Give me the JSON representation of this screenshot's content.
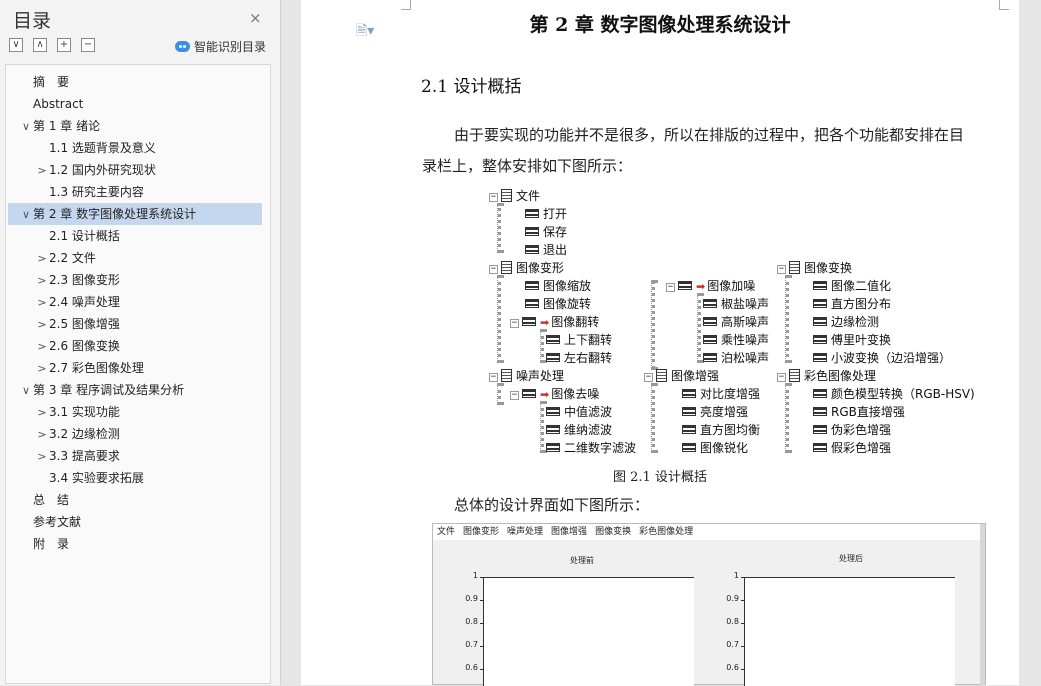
{
  "sidebar": {
    "title": "目录",
    "close": "×",
    "tools": [
      "∨",
      "∧",
      "+",
      "−"
    ],
    "ai_button": "智能识别目录",
    "items": [
      {
        "label": "摘　要",
        "level": 0,
        "chev": "",
        "selected": false
      },
      {
        "label": "Abstract",
        "level": 0,
        "chev": "",
        "selected": false
      },
      {
        "label": "第 1 章  绪论",
        "level": 0,
        "chev": "∨",
        "selected": false
      },
      {
        "label": "1.1 选题背景及意义",
        "level": 1,
        "chev": "",
        "selected": false
      },
      {
        "label": "1.2 国内外研究现状",
        "level": 1,
        "chev": ">",
        "selected": false
      },
      {
        "label": "1.3 研究主要内容",
        "level": 1,
        "chev": "",
        "selected": false
      },
      {
        "label": "第 2 章  数字图像处理系统设计",
        "level": 0,
        "chev": "∨",
        "selected": true
      },
      {
        "label": "2.1 设计概括",
        "level": 1,
        "chev": "",
        "selected": false
      },
      {
        "label": "2.2 文件",
        "level": 1,
        "chev": ">",
        "selected": false
      },
      {
        "label": "2.3 图像变形",
        "level": 1,
        "chev": ">",
        "selected": false
      },
      {
        "label": "2.4 噪声处理",
        "level": 1,
        "chev": ">",
        "selected": false
      },
      {
        "label": "2.5 图像增强",
        "level": 1,
        "chev": ">",
        "selected": false
      },
      {
        "label": "2.6 图像变换",
        "level": 1,
        "chev": ">",
        "selected": false
      },
      {
        "label": "2.7 彩色图像处理",
        "level": 1,
        "chev": ">",
        "selected": false
      },
      {
        "label": "第 3 章  程序调试及结果分析",
        "level": 0,
        "chev": "∨",
        "selected": false
      },
      {
        "label": "3.1 实现功能",
        "level": 1,
        "chev": ">",
        "selected": false
      },
      {
        "label": "3.2 边缘检测",
        "level": 1,
        "chev": ">",
        "selected": false
      },
      {
        "label": "3.3 提高要求",
        "level": 1,
        "chev": ">",
        "selected": false
      },
      {
        "label": "3.4 实验要求拓展",
        "level": 1,
        "chev": "",
        "selected": false
      },
      {
        "label": "总　结",
        "level": 0,
        "chev": "",
        "selected": false
      },
      {
        "label": "参考文献",
        "level": 0,
        "chev": "",
        "selected": false
      },
      {
        "label": "附　录",
        "level": 0,
        "chev": "",
        "selected": false
      }
    ]
  },
  "document": {
    "chapter_title": "第 2 章  数字图像处理系统设计",
    "section_title": "2.1 设计概括",
    "para1_line1": "由于要实现的功能并不是很多，所以在排版的过程中，把各个功能都安排在目",
    "para1_line2": "录栏上，整体安排如下图所示：",
    "fig_caption": "图 2.1  设计概括",
    "para2": "总体的设计界面如下图所示：",
    "tree": {
      "file": {
        "label": "文件",
        "items": [
          "打开",
          "保存",
          "退出"
        ]
      },
      "deform": {
        "label": "图像变形",
        "items": [
          "图像缩放",
          "图像旋转"
        ],
        "flip": {
          "label": "图像翻转",
          "items": [
            "上下翻转",
            "左右翻转"
          ]
        }
      },
      "noise_add": {
        "label": "图像加噪",
        "items": [
          "椒盐噪声",
          "高斯噪声",
          "乘性噪声",
          "泊松噪声"
        ]
      },
      "transform": {
        "label": "图像变换",
        "items": [
          "图像二值化",
          "直方图分布",
          "边缘检测",
          "傅里叶变换",
          "小波变换（边沿增强）"
        ]
      },
      "noise": {
        "label": "噪声处理",
        "denoise": {
          "label": "图像去噪",
          "items": [
            "中值滤波",
            "维纳滤波",
            "二维数字滤波"
          ]
        }
      },
      "enhance": {
        "label": "图像增强",
        "items": [
          "对比度增强",
          "亮度增强",
          "直方图均衡",
          "图像锐化"
        ]
      },
      "color": {
        "label": "彩色图像处理",
        "items": [
          "颜色模型转换（RGB-HSV)",
          "RGB直接增强",
          "伪彩色增强",
          "假彩色增强"
        ]
      }
    },
    "screenshot": {
      "menu": [
        "文件",
        "图像变形",
        "噪声处理",
        "图像增强",
        "图像变换",
        "彩色图像处理"
      ],
      "plot_left_title": "处理前",
      "plot_right_title": "处理后",
      "yticks": [
        "1",
        "0.9",
        "0.8",
        "0.7",
        "0.6"
      ]
    }
  }
}
